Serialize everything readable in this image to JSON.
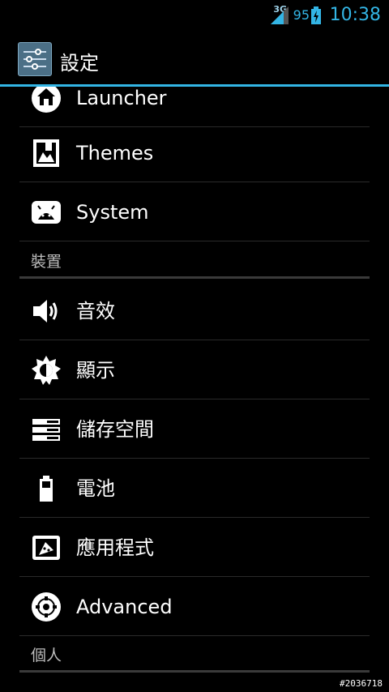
{
  "status_bar": {
    "network_type": "3G",
    "battery_percent": "95",
    "time": "10:38",
    "accent_color": "#33b5e5"
  },
  "action_bar": {
    "title": "設定",
    "icon": "settings-sliders-icon"
  },
  "list": [
    {
      "type": "item",
      "label": "Launcher",
      "icon": "home-icon"
    },
    {
      "type": "item",
      "label": "Themes",
      "icon": "themes-icon"
    },
    {
      "type": "item",
      "label": "System",
      "icon": "android-box-icon"
    },
    {
      "type": "header",
      "label": "裝置"
    },
    {
      "type": "item",
      "label": "音效",
      "icon": "volume-icon"
    },
    {
      "type": "item",
      "label": "顯示",
      "icon": "brightness-icon"
    },
    {
      "type": "item",
      "label": "儲存空間",
      "icon": "storage-icon"
    },
    {
      "type": "item",
      "label": "電池",
      "icon": "battery-icon"
    },
    {
      "type": "item",
      "label": "應用程式",
      "icon": "apps-icon"
    },
    {
      "type": "item",
      "label": "Advanced",
      "icon": "advanced-gear-icon"
    },
    {
      "type": "header",
      "label": "個人"
    }
  ],
  "watermark": "#2036718"
}
